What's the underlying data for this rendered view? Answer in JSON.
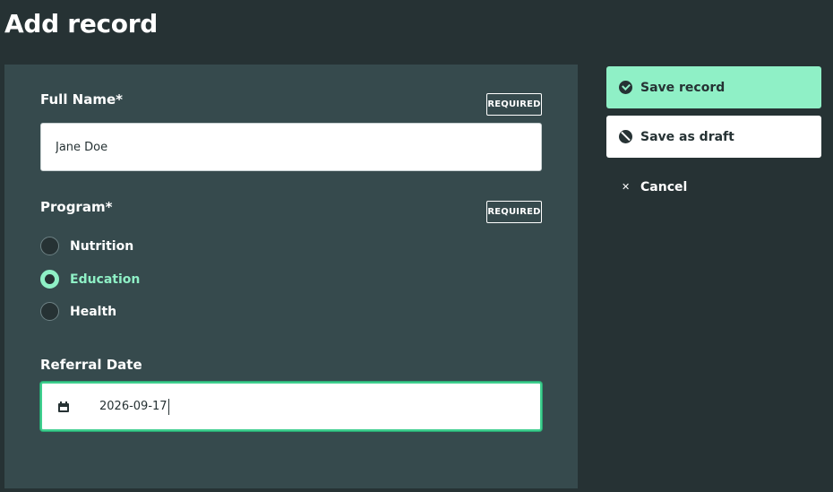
{
  "page": {
    "title": "Add record"
  },
  "form": {
    "full_name": {
      "label": "Full Name*",
      "badge": "REQUIRED",
      "value": "Jane Doe",
      "placeholder": ""
    },
    "program": {
      "label": "Program*",
      "badge": "REQUIRED",
      "options": [
        {
          "label": "Nutrition",
          "selected": false
        },
        {
          "label": "Education",
          "selected": true
        },
        {
          "label": "Health",
          "selected": false
        }
      ]
    },
    "referral_date": {
      "label": "Referral Date",
      "value": "2026-09-17",
      "icon": "calendar-icon"
    }
  },
  "actions": {
    "save_label": "Save record",
    "save_icon": "check-circle-icon",
    "draft_label": "Save as draft",
    "draft_icon": "block-icon",
    "cancel_label": "Cancel",
    "cancel_icon": "close-icon"
  },
  "colors": {
    "background": "#263234",
    "card": "#364a4d",
    "accent": "#8ff0c6",
    "focus": "#3ecf8e"
  }
}
